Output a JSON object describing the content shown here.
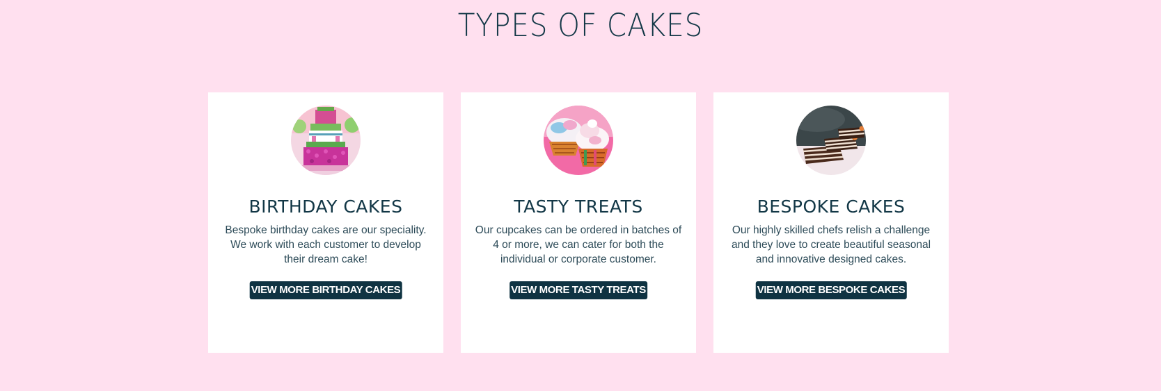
{
  "section": {
    "title": "TYPES OF CAKES"
  },
  "cards": [
    {
      "image_icon": "birthday-cake-photo",
      "title": "BIRTHDAY CAKES",
      "description": "Bespoke birthday cakes are our speciality. We work with each customer to develop their dream cake!",
      "button_label": "VIEW MORE BIRTHDAY CAKES"
    },
    {
      "image_icon": "cupcakes-photo",
      "title": "TASTY TREATS",
      "description": "Our cupcakes can be ordered in batches of 4 or more, we can cater for both the individual or corporate customer.",
      "button_label": "VIEW MORE TASTY TREATS"
    },
    {
      "image_icon": "layered-cake-slices-photo",
      "title": "BESPOKE CAKES",
      "description": "Our highly skilled chefs relish a challenge and they love to create beautiful seasonal and innovative designed cakes.",
      "button_label": "VIEW MORE BESPOKE CAKES"
    }
  ],
  "colors": {
    "page_background": "#ffe0ef",
    "card_background": "#ffffff",
    "heading_text": "#123746",
    "button_background": "#0f3342",
    "button_text": "#ffffff"
  }
}
